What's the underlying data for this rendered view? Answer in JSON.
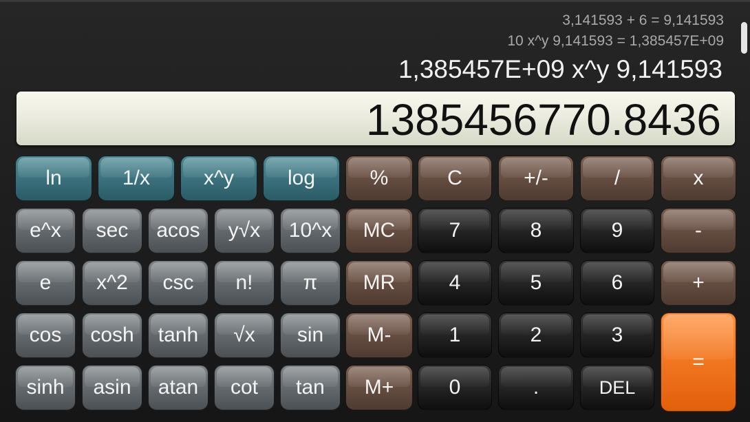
{
  "history": [
    "3,141593 + 6 = 9,141593",
    "10 x^y 9,141593 = 1,385457E+09"
  ],
  "expression": "1,385457E+09 x^y 9,141593",
  "display": "1385456770.8436",
  "colors": {
    "teal": "#3c7680",
    "brown": "#654c40",
    "gray": "#62686c",
    "black": "#1e1e1e",
    "orange": "#f27418",
    "display_bg": "#ecede0"
  },
  "keys": {
    "ln": "ln",
    "inv": "1/x",
    "pow": "x^y",
    "log": "log",
    "percent": "%",
    "clear": "C",
    "plusminus": "+/-",
    "divide": "/",
    "multiply": "x",
    "exp": "e^x",
    "sec": "sec",
    "acos": "acos",
    "yroot": "y√x",
    "pow10": "10^x",
    "mc": "MC",
    "d7": "7",
    "d8": "8",
    "d9": "9",
    "minus": "-",
    "e": "e",
    "square": "x^2",
    "csc": "csc",
    "fact": "n!",
    "pi": "π",
    "mr": "MR",
    "d4": "4",
    "d5": "5",
    "d6": "6",
    "plus": "+",
    "cos": "cos",
    "cosh": "cosh",
    "tanh": "tanh",
    "sqrt": "√x",
    "sin": "sin",
    "mminus": "M-",
    "d1": "1",
    "d2": "2",
    "d3": "3",
    "equals": "=",
    "sinh": "sinh",
    "asin": "asin",
    "atan": "atan",
    "cot": "cot",
    "tan": "tan",
    "mplus": "M+",
    "d0": "0",
    "dot": ".",
    "del": "DEL"
  }
}
